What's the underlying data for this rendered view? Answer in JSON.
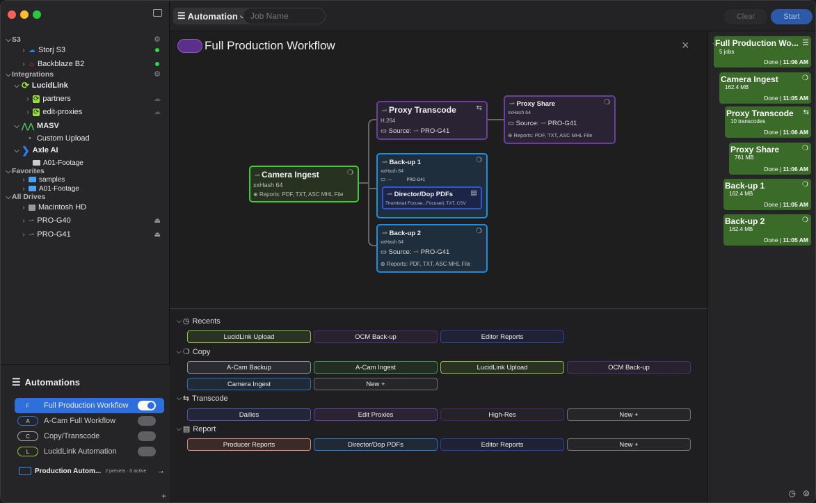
{
  "sidebar": {
    "s3": {
      "label": "S3",
      "items": [
        {
          "label": "Storj S3"
        },
        {
          "label": "Backblaze B2"
        }
      ]
    },
    "integrations": {
      "label": "Integrations",
      "lucidlink": {
        "label": "LucidLink",
        "items": [
          "partners",
          "edit-proxies"
        ]
      },
      "masv": {
        "label": "MASV",
        "items": [
          "Custom Upload"
        ]
      },
      "axle": {
        "label": "Axle AI",
        "items": [
          "A01-Footage"
        ]
      }
    },
    "favorites": {
      "label": "Favorites",
      "items": [
        "samples",
        "A01-Footage"
      ]
    },
    "drives": {
      "label": "All Drives",
      "items": [
        "Macintosh HD",
        "PRO-G40",
        "PRO-G41"
      ]
    }
  },
  "automations": {
    "title": "Automations",
    "items": [
      {
        "badge": "F",
        "label": "Full Production Workflow",
        "on": true
      },
      {
        "badge": "A",
        "label": "A-Cam Full Workflow",
        "on": false
      },
      {
        "badge": "C",
        "label": "Copy/Transcode",
        "on": false
      },
      {
        "badge": "L",
        "label": "LucidLink Automation",
        "on": false
      }
    ],
    "footer": {
      "label": "Production Autom...",
      "meta": "2 presets · 0 active",
      "arrow": "→"
    },
    "add": "+"
  },
  "toolbar": {
    "mode": "Automation",
    "job_placeholder": "Job Name",
    "clear": "Clear",
    "start": "Start"
  },
  "workflow": {
    "title": "Full Production Workflow",
    "close": "×",
    "nodes": {
      "camera": {
        "title": "Camera Ingest",
        "hash": "xxHash 64",
        "reports": "Reports: PDF, TXT, ASC MHL File"
      },
      "proxy": {
        "title": "Proxy Transcode",
        "codec": "H.264",
        "source_label": "Source:",
        "source": "PRO-G41"
      },
      "share": {
        "title": "Proxy Share",
        "hash": "xxHash 64",
        "source_label": "Source:",
        "source": "PRO-G41",
        "reports": "Reports: PDF, TXT, ASC MHL File"
      },
      "backup1": {
        "title": "Back-up 1",
        "hash": "xxHash 64",
        "dest": "---",
        "dest2": "PRO-G41",
        "sub_title": "Director/Dop PDFs",
        "sub_detail": "Thumbnail Focuse...Focused, TXT, CSV"
      },
      "backup2": {
        "title": "Back-up 2",
        "hash": "xxHash 64",
        "source_label": "Source:",
        "source": "PRO-G41",
        "reports": "Reports: PDF, TXT, ASC MHL File"
      }
    }
  },
  "presets": {
    "recents": {
      "label": "Recents",
      "items": [
        "LucidLink Upload",
        "OCM Back-up",
        "Editor Reports"
      ]
    },
    "copy": {
      "label": "Copy",
      "items": [
        "A-Cam Backup",
        "A-Cam Ingest",
        "LucidLink Upload",
        "OCM Back-up",
        "Camera Ingest",
        "New +"
      ]
    },
    "transcode": {
      "label": "Transcode",
      "items": [
        "Dailies",
        "Edit Proxies",
        "High-Res",
        "New +"
      ]
    },
    "report": {
      "label": "Report",
      "items": [
        "Producer Reports",
        "Director/Dop PDFs",
        "Editor Reports",
        "New +"
      ]
    }
  },
  "jobs": [
    {
      "title": "Full Production Wo...",
      "sub": "5 jobs",
      "status": "Done",
      "time": "11:06 AM"
    },
    {
      "title": "Camera Ingest",
      "sub": "162.4 MB",
      "status": "Done",
      "time": "11:05 AM"
    },
    {
      "title": "Proxy Transcode",
      "sub": "10 transcodes",
      "status": "Done",
      "time": "11:06 AM"
    },
    {
      "title": "Proxy Share",
      "sub": "761 MB",
      "status": "Done",
      "time": "11:06 AM"
    },
    {
      "title": "Back-up 1",
      "sub": "162.4 MB",
      "status": "Done",
      "time": "11:05 AM"
    },
    {
      "title": "Back-up 2",
      "sub": "162.4 MB",
      "status": "Done",
      "time": "11:05 AM"
    }
  ],
  "colors": {
    "green": "#4cd137",
    "purple": "#6a3fa0",
    "blue": "#1e8fe0",
    "accent": "#2f7bf6",
    "job_green": "#3a6b28"
  }
}
